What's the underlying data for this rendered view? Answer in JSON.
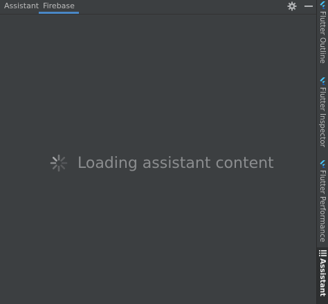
{
  "tabs": [
    {
      "label": "Assistant",
      "active": false
    },
    {
      "label": "Firebase",
      "active": true
    }
  ],
  "toolbar": {
    "settings_icon": "gear-icon",
    "minimize_icon": "minimize-icon"
  },
  "content": {
    "loading_text": "Loading assistant content",
    "spinner_icon": "spinner-icon"
  },
  "side_panel": {
    "items": [
      {
        "label": "Flutter Outline",
        "icon": "flutter-icon"
      },
      {
        "label": "Flutter Inspector",
        "icon": "flutter-icon"
      },
      {
        "label": "Flutter Performance",
        "icon": "flutter-icon"
      },
      {
        "label": "Assistant",
        "icon": "list-icon",
        "selected": true
      }
    ]
  },
  "colors": {
    "background": "#3c3f41",
    "accent": "#4a88c7",
    "text": "#bbbbbb",
    "muted_text": "#8b8d8f",
    "flutter_blue": "#47c5fb"
  }
}
